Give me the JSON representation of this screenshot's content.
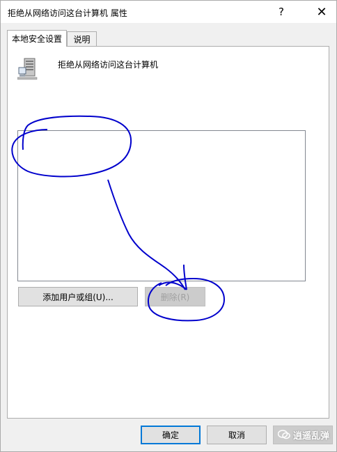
{
  "window": {
    "title": "拒绝从网络访问这台计算机 属性",
    "help_glyph": "?",
    "close_glyph": "✕"
  },
  "tabs": [
    {
      "label": "本地安全设置",
      "active": true
    },
    {
      "label": "说明",
      "active": false
    }
  ],
  "policy": {
    "icon": "server-computer-icon",
    "name": "拒绝从网络访问这台计算机"
  },
  "members_list": {
    "items": []
  },
  "buttons": {
    "add_label": "添加用户或组(U)...",
    "remove_label": "删除(R)",
    "ok_label": "确定",
    "cancel_label": "取消"
  },
  "watermark": {
    "text": "逍遥乱弹",
    "icon": "chat-bubble-icon"
  },
  "annotation_color": "#0000cc"
}
